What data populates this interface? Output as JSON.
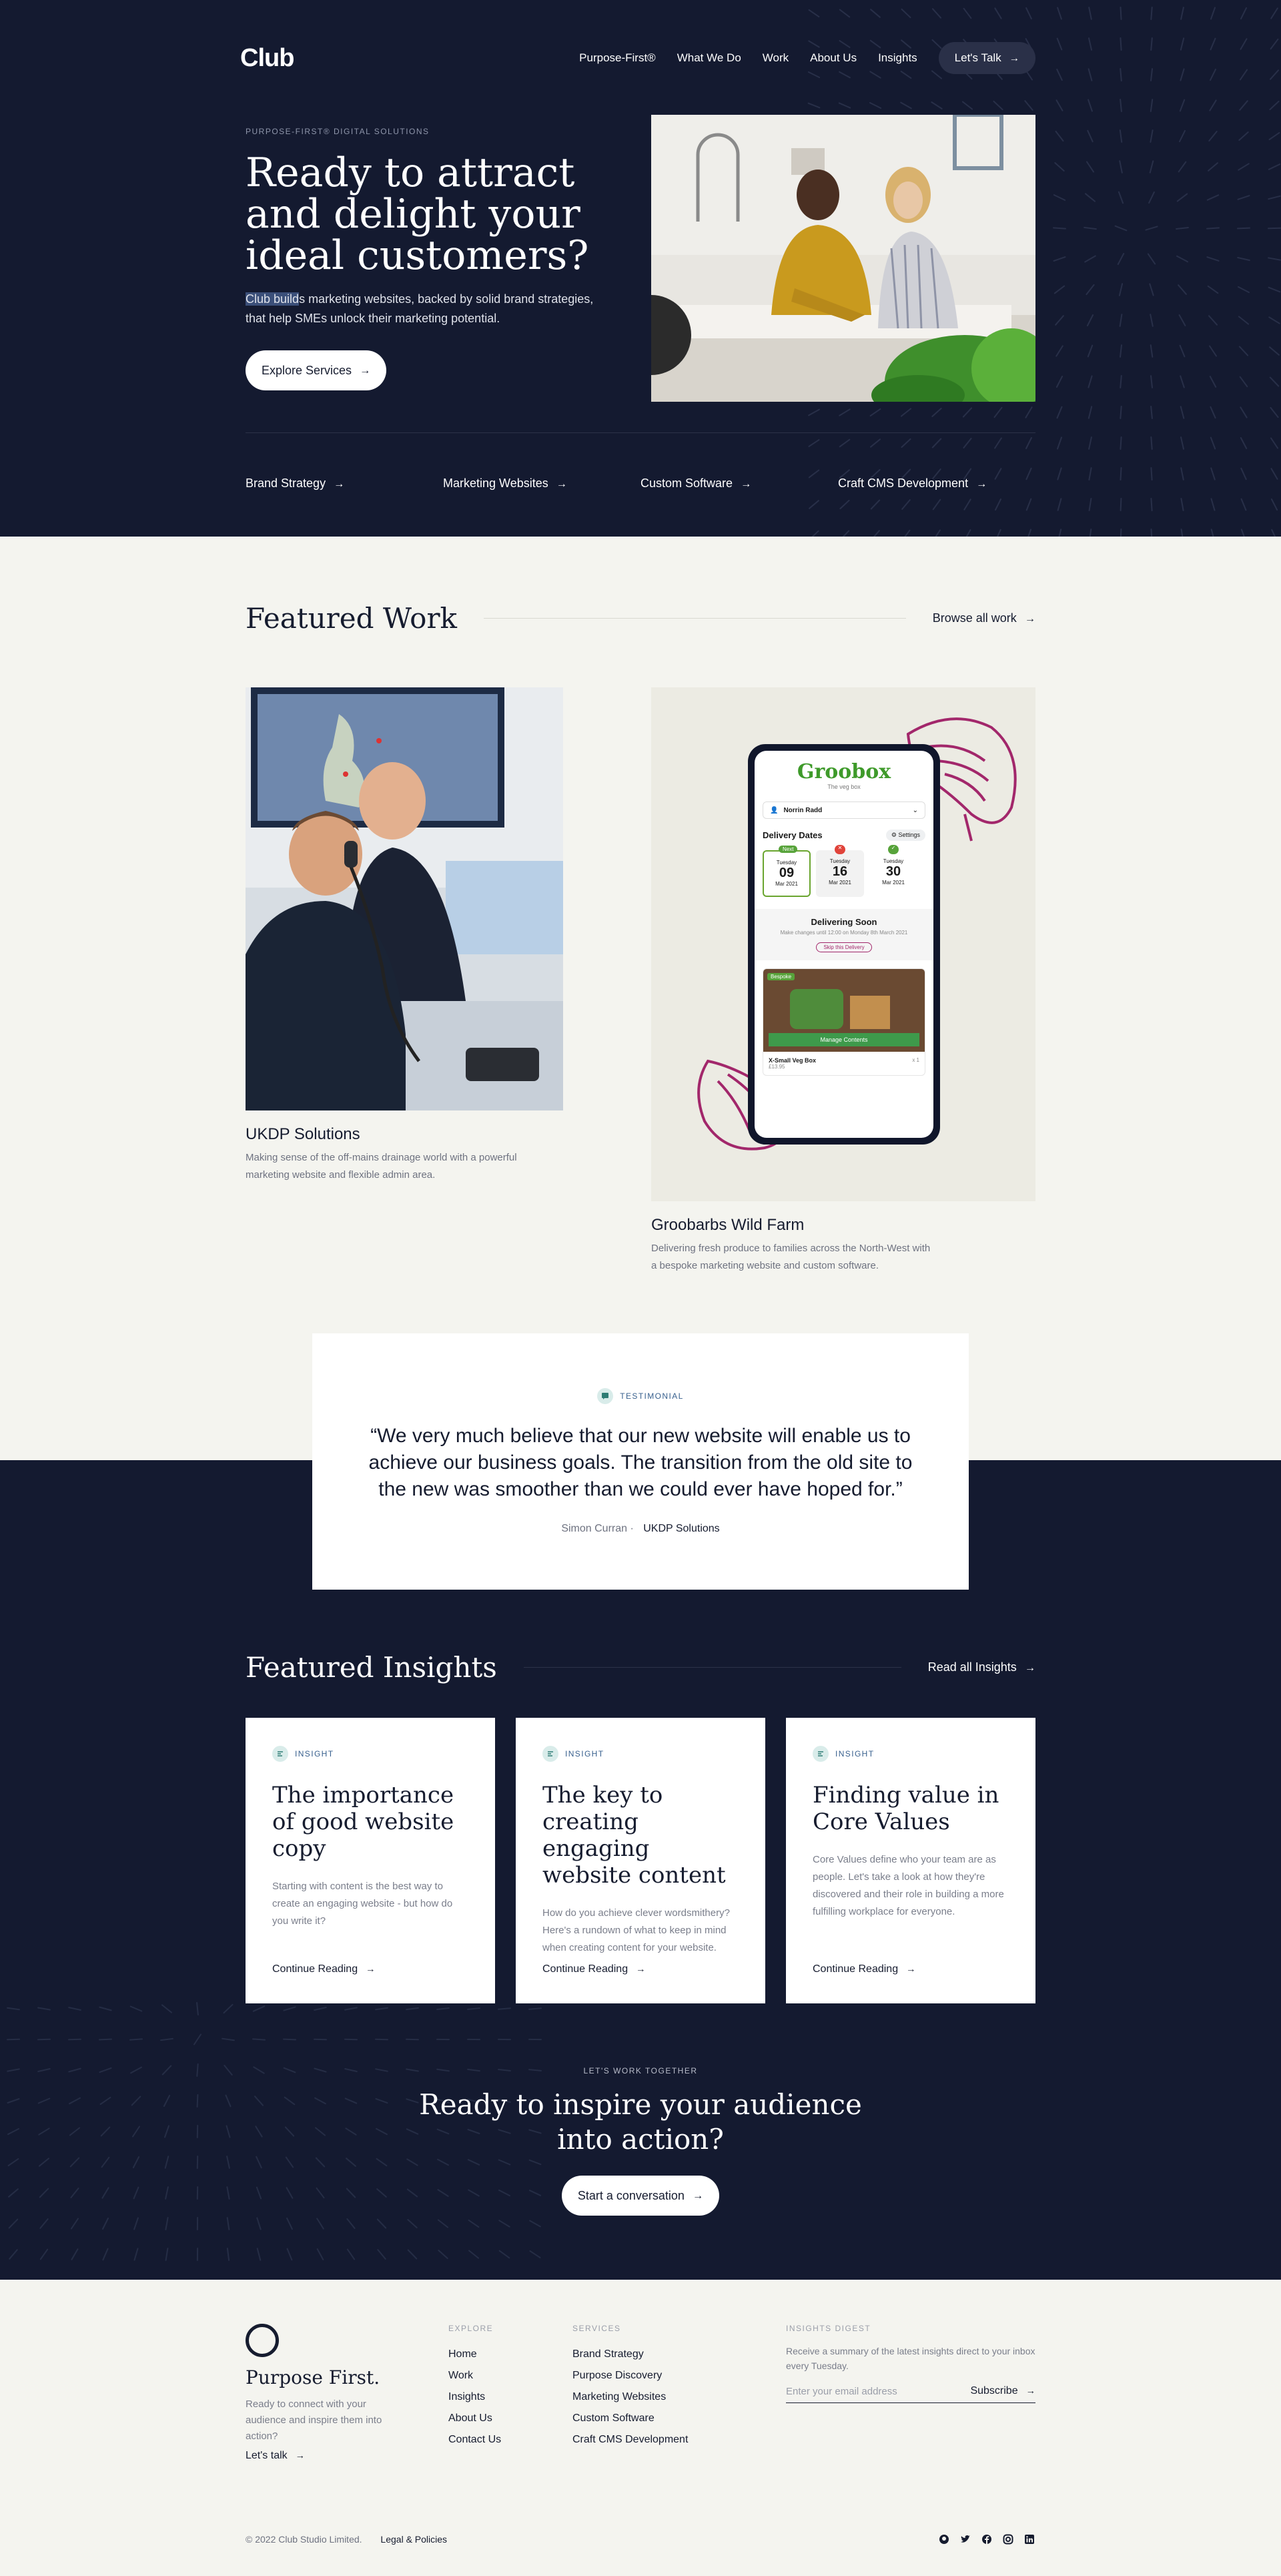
{
  "nav": {
    "logo": "Club",
    "links": [
      "Purpose-First®",
      "What We Do",
      "Work",
      "About Us",
      "Insights"
    ],
    "cta": "Let's Talk"
  },
  "hero": {
    "eyebrow": "PURPOSE-FIRST® DIGITAL SOLUTIONS",
    "title": "Ready to attract and delight your ideal customers?",
    "subtitle_highlight": "Club build",
    "subtitle_rest": "s marketing websites, backed by solid brand strategies, that help SMEs unlock their marketing potential.",
    "button": "Explore Services",
    "services": [
      "Brand Strategy",
      "Marketing Websites",
      "Custom Software",
      "Craft CMS Development"
    ]
  },
  "work": {
    "title": "Featured Work",
    "browse": "Browse all work",
    "cases": [
      {
        "title": "UKDP Solutions",
        "desc": "Making sense of the off-mains drainage world with a powerful marketing website and flexible admin area."
      },
      {
        "title": "Groobarbs Wild Farm",
        "desc": "Delivering fresh produce to families across the North-West with a bespoke marketing website and custom software."
      }
    ],
    "app": {
      "brand": "Groobox",
      "brand_sub": "The veg box",
      "user": "Norrin Radd",
      "delivery_title": "Delivery Dates",
      "settings": "Settings",
      "dates": [
        {
          "badge": "Next",
          "day": "Tuesday",
          "date": "09",
          "month": "Mar 2021"
        },
        {
          "badge": "",
          "day": "Tuesday",
          "date": "16",
          "month": "Mar 2021"
        },
        {
          "badge": "",
          "day": "Tuesday",
          "date": "30",
          "month": "Mar 2021"
        }
      ],
      "soon_title": "Delivering Soon",
      "soon_sub": "Make changes until 12:00 on Monday 8th March 2021",
      "skip": "Skip this Delivery",
      "manage": "Manage Contents",
      "product": "X-Small Veg Box",
      "price": "£13.95",
      "qty": "x 1",
      "tag": "Bespoke"
    }
  },
  "testimonial": {
    "tag": "TESTIMONIAL",
    "quote": "“We very much believe that our new website will enable us to achieve our business goals. The transition from the old site to the new was smoother than we could ever have hoped for.”",
    "author": "Simon Curran",
    "company": "UKDP Solutions"
  },
  "insights": {
    "title": "Featured Insights",
    "read_all": "Read all Insights",
    "tag": "INSIGHT",
    "more": "Continue Reading",
    "cards": [
      {
        "title": "The importance of good website copy",
        "desc": "Starting with content is the best way to create an engaging website - but how do you write it?"
      },
      {
        "title": "The key to creating engaging website content",
        "desc": "How do you achieve clever wordsmithery? Here's a rundown of what to keep in mind when creating content for your website."
      },
      {
        "title": "Finding value in Core Values",
        "desc": "Core Values define who your team are as people. Let's take a look at how they're discovered and their role in building a more fulfilling workplace for everyone."
      }
    ]
  },
  "cta": {
    "eyebrow": "LET'S WORK TOGETHER",
    "title": "Ready to inspire your audience into action?",
    "button": "Start a conversation"
  },
  "footer": {
    "brand_title": "Purpose First.",
    "brand_desc": "Ready to connect with your audience and inspire them into action?",
    "brand_link": "Let's talk",
    "explore_title": "EXPLORE",
    "explore": [
      "Home",
      "Work",
      "Insights",
      "About Us",
      "Contact Us"
    ],
    "services_title": "SERVICES",
    "services": [
      "Brand Strategy",
      "Purpose Discovery",
      "Marketing Websites",
      "Custom Software",
      "Craft CMS Development"
    ],
    "digest_title": "INSIGHTS DIGEST",
    "digest_desc": "Receive a summary of the latest insights direct to your inbox every Tuesday.",
    "email_placeholder": "Enter your email address",
    "subscribe": "Subscribe",
    "copyright": "© 2022 Club Studio Limited.",
    "legal": "Legal & Policies",
    "socials": [
      "github-icon",
      "twitter-icon",
      "facebook-icon",
      "instagram-icon",
      "linkedin-icon"
    ]
  }
}
